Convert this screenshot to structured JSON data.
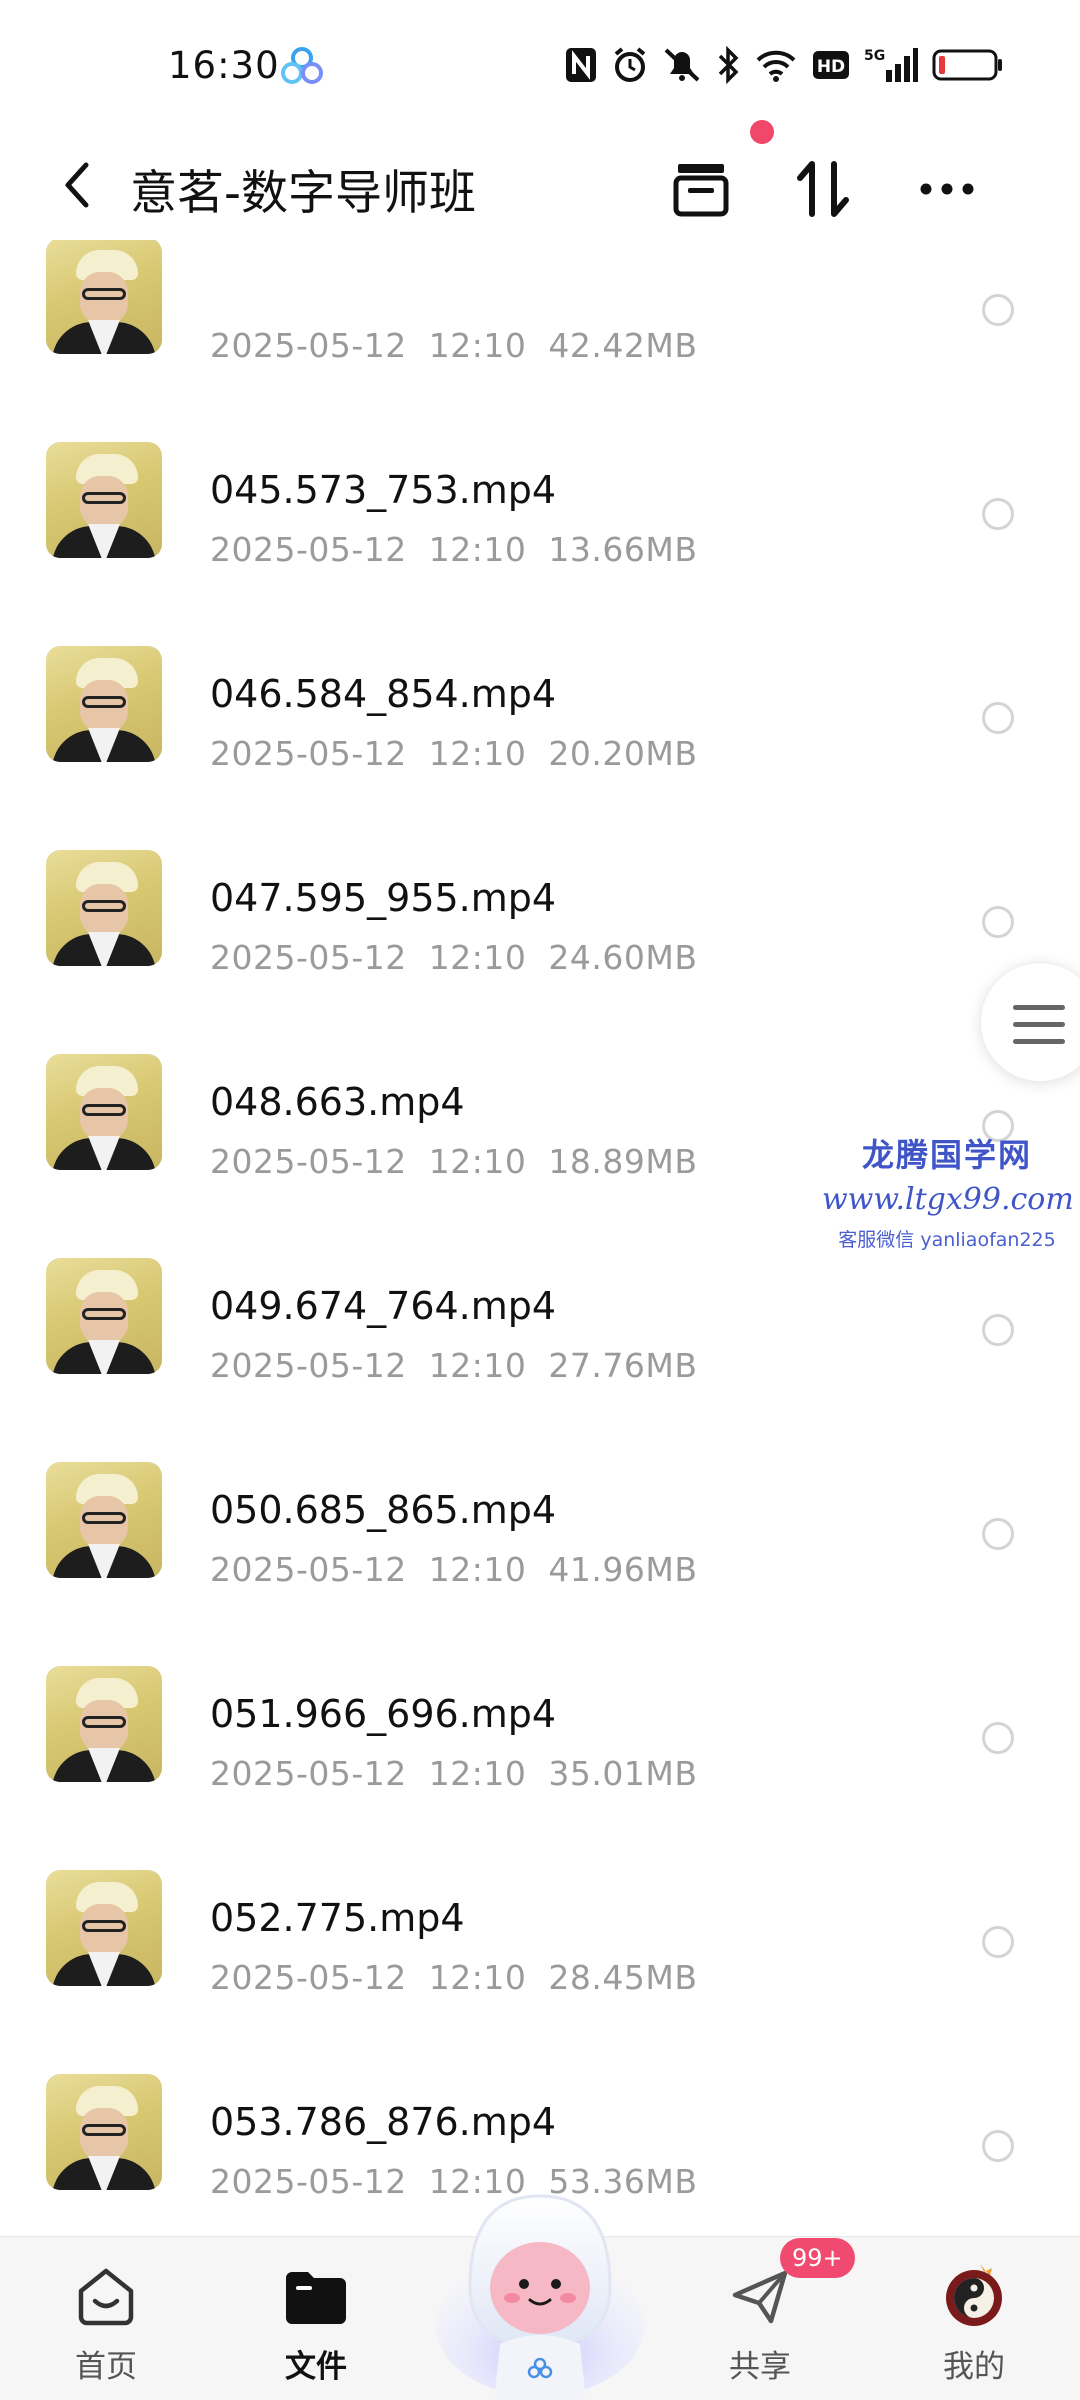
{
  "status_bar": {
    "time": "16:30",
    "icons": [
      "nfc-icon",
      "alarm-icon",
      "mute-icon",
      "bluetooth-icon",
      "wifi-icon",
      "hd-icon",
      "5g-signal-icon",
      "battery-icon"
    ],
    "signal_label": "5G",
    "hd_label": "HD"
  },
  "header": {
    "title": "意茗-数字导师班",
    "actions": [
      "archive-icon",
      "sort-icon",
      "more-icon"
    ]
  },
  "files": [
    {
      "name": "",
      "date": "2025-05-12",
      "time": "12:10",
      "size": "42.42MB"
    },
    {
      "name": "045.573_753.mp4",
      "date": "2025-05-12",
      "time": "12:10",
      "size": "13.66MB"
    },
    {
      "name": "046.584_854.mp4",
      "date": "2025-05-12",
      "time": "12:10",
      "size": "20.20MB"
    },
    {
      "name": "047.595_955.mp4",
      "date": "2025-05-12",
      "time": "12:10",
      "size": "24.60MB"
    },
    {
      "name": "048.663.mp4",
      "date": "2025-05-12",
      "time": "12:10",
      "size": "18.89MB"
    },
    {
      "name": "049.674_764.mp4",
      "date": "2025-05-12",
      "time": "12:10",
      "size": "27.76MB"
    },
    {
      "name": "050.685_865.mp4",
      "date": "2025-05-12",
      "time": "12:10",
      "size": "41.96MB"
    },
    {
      "name": "051.966_696.mp4",
      "date": "2025-05-12",
      "time": "12:10",
      "size": "35.01MB"
    },
    {
      "name": "052.775.mp4",
      "date": "2025-05-12",
      "time": "12:10",
      "size": "28.45MB"
    },
    {
      "name": "053.786_876.mp4",
      "date": "2025-05-12",
      "time": "12:10",
      "size": "53.36MB"
    }
  ],
  "watermark": {
    "line1": "龙腾国学网",
    "line2": "www.ltgx99.com",
    "line3": "客服微信 yanliaofan225"
  },
  "bottom_nav": {
    "items": [
      {
        "label": "首页",
        "icon": "home-icon",
        "active": false
      },
      {
        "label": "文件",
        "icon": "folder-icon",
        "active": true
      },
      {
        "label": "共享",
        "icon": "share-send-icon",
        "active": false
      },
      {
        "label": "我的",
        "icon": "avatar-icon",
        "active": false
      }
    ],
    "share_badge": "99+"
  },
  "colors": {
    "accent": "#f0476a",
    "meta_text": "#9a9a9a",
    "watermark": "#3f55c8"
  }
}
